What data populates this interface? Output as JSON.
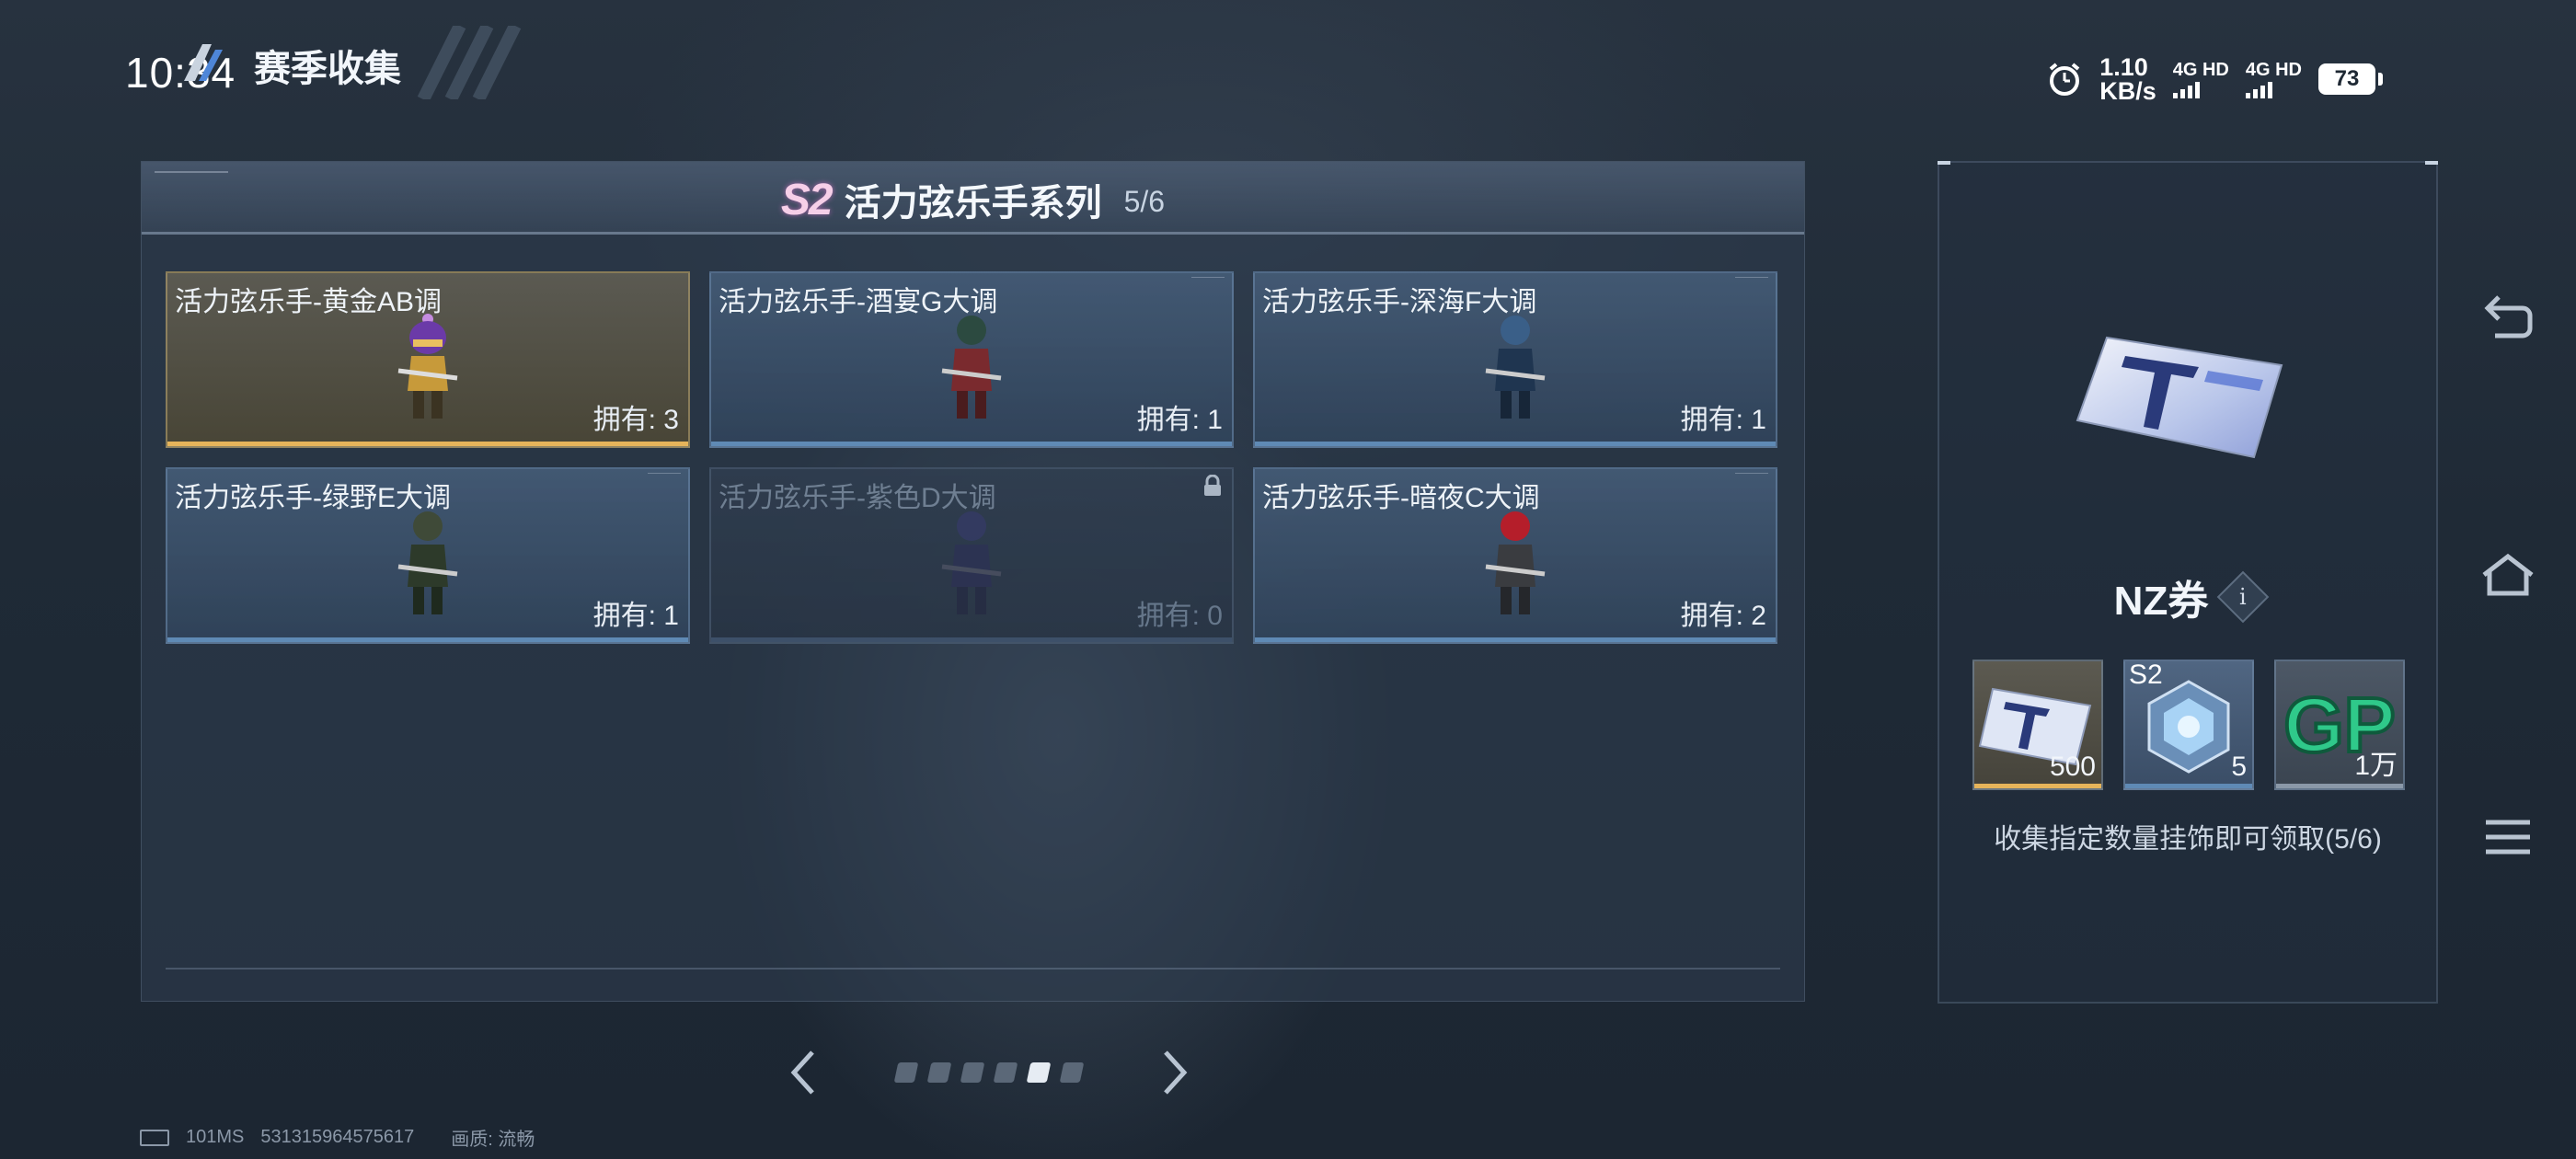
{
  "status_bar": {
    "time": "10:34",
    "net_speed_value": "1.10",
    "net_speed_unit": "KB/s",
    "sim1": "4G HD",
    "sim2": "4G HD",
    "battery": "73"
  },
  "page": {
    "title": "赛季收集"
  },
  "series": {
    "badge": "S2",
    "name": "活力弦乐手系列",
    "progress": "5/6"
  },
  "cards": [
    {
      "name": "活力弦乐手-黄金AB调",
      "owned": "拥有: 3",
      "rarity": "gold"
    },
    {
      "name": "活力弦乐手-酒宴G大调",
      "owned": "拥有: 1",
      "rarity": "blue"
    },
    {
      "name": "活力弦乐手-深海F大调",
      "owned": "拥有: 1",
      "rarity": "blue"
    },
    {
      "name": "活力弦乐手-绿野E大调",
      "owned": "拥有: 1",
      "rarity": "blue"
    },
    {
      "name": "活力弦乐手-紫色D大调",
      "owned": "拥有: 0",
      "rarity": "locked"
    },
    {
      "name": "活力弦乐手-暗夜C大调",
      "owned": "拥有: 2",
      "rarity": "blue"
    }
  ],
  "pager": {
    "total_pages": 6,
    "active_page": 5
  },
  "footer": {
    "ping": "101MS",
    "uid": "531315964575617",
    "quality": "画质: 流畅"
  },
  "reward_panel": {
    "item_name": "NZ券",
    "rewards": [
      {
        "icon": "nz-ticket-icon",
        "qty": "500",
        "tag": ""
      },
      {
        "icon": "s2-crystal-icon",
        "qty": "5",
        "tag": "S2"
      },
      {
        "icon": "gp-icon",
        "qty": "1万",
        "tag": ""
      }
    ],
    "claim_text": "收集指定数量挂饰即可领取(5/6)"
  },
  "colors": {
    "gold_accent": "#e6b45a",
    "blue_accent": "#5f8ab5",
    "s2_pink": "#f6cfe8"
  }
}
